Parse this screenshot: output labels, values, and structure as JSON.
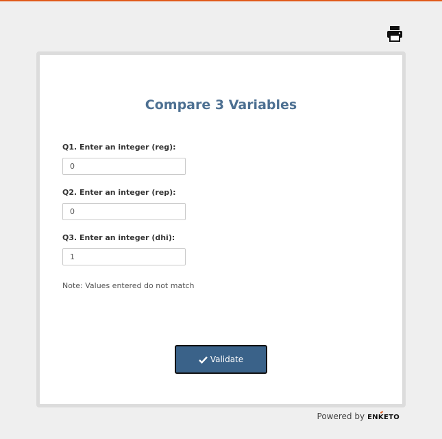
{
  "form": {
    "title": "Compare 3 Variables",
    "questions": [
      {
        "label": "Q1. Enter an integer (reg):",
        "value": "0"
      },
      {
        "label": "Q2. Enter an integer (rep):",
        "value": "0"
      },
      {
        "label": "Q3. Enter an integer (dhi):",
        "value": "1"
      }
    ],
    "note": "Note: Values entered do not match",
    "validate_label": "Validate"
  },
  "footer": {
    "powered_by": "Powered by",
    "brand": "ENKETO"
  },
  "icons": {
    "print": "printer-icon",
    "validate": "check-icon"
  },
  "colors": {
    "top_accent": "#e05a1a",
    "title": "#4d7092",
    "button": "#3a6289"
  }
}
